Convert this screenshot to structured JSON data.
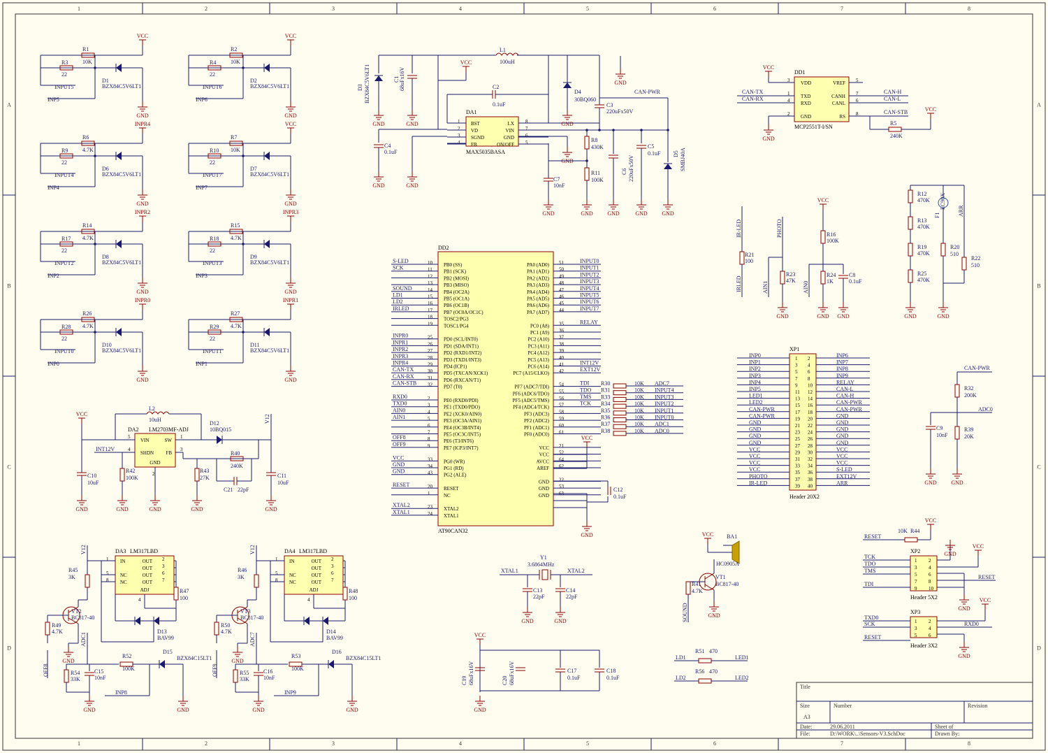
{
  "colors": {
    "wire": "#1a1a6e",
    "part": "#8b0000",
    "fill": "#ffffb0",
    "paper": "#fffdf0"
  },
  "border": {
    "cols": [
      "1",
      "2",
      "3",
      "4",
      "5",
      "6",
      "7",
      "8"
    ],
    "rows": [
      "A",
      "B",
      "C",
      "D"
    ]
  },
  "title_block": {
    "title_label": "Title",
    "size_label": "Size",
    "size": "A3",
    "number_label": "Number",
    "revision_label": "Revision",
    "date_label": "Date:",
    "date": "29.06.2011",
    "file_label": "File:",
    "file": "D:\\WORK\\..\\Sensors-V3.SchDoc",
    "sheet_label": "Sheet   of",
    "drawn_label": "Drawn By:"
  },
  "inputs": [
    {
      "r1": "R1",
      "r1v": "10K",
      "r2": "R3",
      "r2v": "22",
      "d": "D1",
      "dv": "BZX84C5V6LT1",
      "top": "VCC",
      "net": "INPUT5",
      "inp": "INP5"
    },
    {
      "r1": "R2",
      "r1v": "10K",
      "r2": "R4",
      "r2v": "22",
      "d": "D2",
      "dv": "BZX84C5V6LT1",
      "top": "VCC",
      "net": "INPUT6",
      "inp": "INP6"
    },
    {
      "r1": "R6",
      "r1v": "4.7K",
      "r2": "R9",
      "r2v": "22",
      "d": "D6",
      "dv": "BZX84C5V6LT1",
      "top": "INPR4",
      "net": "INPUT4",
      "inp": "INP4"
    },
    {
      "r1": "R7",
      "r1v": "10K",
      "r2": "R10",
      "r2v": "22",
      "d": "D7",
      "dv": "BZX84C5V6LT1",
      "top": "VCC",
      "net": "INPUT7",
      "inp": "INP7"
    },
    {
      "r1": "R14",
      "r1v": "4.7K",
      "r2": "R17",
      "r2v": "22",
      "d": "D8",
      "dv": "BZX84C5V6LT1",
      "top": "INPR2",
      "net": "INPUT2",
      "inp": "INP2"
    },
    {
      "r1": "R15",
      "r1v": "4.7K",
      "r2": "R18",
      "r2v": "22",
      "d": "D9",
      "dv": "BZX84C5V6LT1",
      "top": "INPR3",
      "net": "INPUT3",
      "inp": "INP3"
    },
    {
      "r1": "R26",
      "r1v": "4.7K",
      "r2": "R28",
      "r2v": "22",
      "d": "D10",
      "dv": "BZX84C5V6LT1",
      "top": "INPR0",
      "net": "INPUT0",
      "inp": "INP0"
    },
    {
      "r1": "R27",
      "r1v": "4.7K",
      "r2": "R29",
      "r2v": "22",
      "d": "D11",
      "dv": "BZX84C5V6LT1",
      "top": "INPR1",
      "net": "INPUT1",
      "inp": "INP1"
    }
  ],
  "gnd": "GND",
  "vcc": "VCC",
  "da1": {
    "name": "DA1",
    "part": "MAX5035BASA",
    "lpins": [
      "BST",
      "VD",
      "SGND",
      "FB"
    ],
    "lnum": [
      "1",
      "2",
      "3",
      "4"
    ],
    "rpins": [
      "LX",
      "VIN",
      "GND",
      "ON/OFF"
    ],
    "rnum": [
      "8",
      "7",
      "6",
      "5"
    ],
    "L1": "L1",
    "L1v": "100uH",
    "C2": "C2",
    "C2v": "0.1uF",
    "D3": "D3",
    "D3v": "BZX84C5V6LT1",
    "C1": "C1",
    "C1v": "68uFx16V",
    "D4": "D4",
    "D4v": "30BQ060",
    "C3": "C3",
    "C3v": "220uFx50V",
    "canpwr": "CAN-PWR",
    "C4": "C4",
    "C4v": "0.1uF",
    "R8": "R8",
    "R8v": "430K",
    "R11": "R11",
    "R11v": "100K",
    "C7": "C7",
    "C7v": "10nF",
    "C6": "C6",
    "C6v": "220uFx50V",
    "C5": "C5",
    "C5v": "0.1uF",
    "D5": "D5",
    "D5v": "SMBJ40A"
  },
  "dd1": {
    "name": "DD1",
    "part": "MCP2551T-I/SN",
    "lpins": [
      "VDD",
      "TXD",
      "RXD",
      "GND"
    ],
    "lnum": [
      "3",
      "1",
      "4",
      "2"
    ],
    "rpins": [
      "VREF",
      "CANH",
      "CANL",
      "RS"
    ],
    "rnum": [
      "5",
      "7",
      "6",
      "8"
    ],
    "ln": [
      "CAN-TX",
      "CAN-RX"
    ],
    "rn": [
      "CAN-H",
      "CAN-L",
      "CAN-STB"
    ],
    "R5": "R5",
    "R5v": "240K"
  },
  "dd2": {
    "name": "DD2",
    "part": "AT90CAN32",
    "l": [
      [
        "PB0 (SS)",
        "10",
        "S-LED"
      ],
      [
        "PB1 (SCK)",
        "11",
        "SCK"
      ],
      [
        "PB2 (MOSI)",
        "12",
        ""
      ],
      [
        "PB3 (MISO)",
        "13",
        ""
      ],
      [
        "PB4 (OC2A)",
        "14",
        "SOUND"
      ],
      [
        "PB5 (OC1A)",
        "15",
        "LD1"
      ],
      [
        "PB6 (OC1B)",
        "16",
        "LD2"
      ],
      [
        "PB7 (OC0A/OC1C)",
        "17",
        "IRLED"
      ],
      [
        "TOSC2/PG3",
        "18",
        ""
      ],
      [
        "TOSC1/PG4",
        "19",
        ""
      ],
      [
        "",
        "",
        " "
      ],
      [
        "PD0 (SCL/INT0)",
        "25",
        "INPR0"
      ],
      [
        "PD1 (SDA/INT1)",
        "26",
        "INPR1"
      ],
      [
        "PD2 (RXD1/INT2)",
        "27",
        "INPR2"
      ],
      [
        "PD3 (TXD1/INT3)",
        "28",
        "INPR3"
      ],
      [
        "PD4 (ICP1)",
        "29",
        "INPR4"
      ],
      [
        "PD5 (TXCAN/XCK1)",
        "30",
        "CAN-TX"
      ],
      [
        "PD6 (RXCAN/T1)",
        "31",
        "CAN-RX"
      ],
      [
        "PD7 (T0)",
        "32",
        "CAN-STB"
      ],
      [
        "",
        "",
        " "
      ],
      [
        "PE0 (RXD0/PDI)",
        "2",
        "RXD0"
      ],
      [
        "PE1 (TXD0/PDO)",
        "3",
        "TXD0"
      ],
      [
        "PE2 (XCK0/AIN0)",
        "4",
        "AIN0"
      ],
      [
        "PE3 (OC3A/AIN1)",
        "5",
        "AIN1"
      ],
      [
        "PE4 (OC3B/INT4)",
        "6",
        ""
      ],
      [
        "PE5 (OC3C/INT5)",
        "7",
        ""
      ],
      [
        "PE6 (T3/INT6)",
        "8",
        "OFF8"
      ],
      [
        "PE7 (ICP3/INT7)",
        "9",
        "OFF9"
      ],
      [
        "",
        "",
        " "
      ],
      [
        "PG0 (WR)",
        "33",
        "VCC"
      ],
      [
        "PG1 (RD)",
        "34",
        "GND"
      ],
      [
        "PG2 (ALE)",
        "43",
        "GND"
      ],
      [
        "",
        "",
        " "
      ],
      [
        "RESET",
        "20",
        "RESET"
      ],
      [
        "NC",
        "1",
        ""
      ],
      [
        "",
        "",
        " "
      ],
      [
        "XTAL2",
        "23",
        "XTAL2"
      ],
      [
        "XTAL1",
        "24",
        "XTAL1"
      ]
    ],
    "r": [
      [
        "PA0 (AD0)",
        "51",
        "INPUT0"
      ],
      [
        "PA1 (AD1)",
        "50",
        "INPUT1"
      ],
      [
        "PA2 (AD2)",
        "49",
        "INPUT2"
      ],
      [
        "PA3 (AD3)",
        "48",
        "INPUT3"
      ],
      [
        "PA4 (AD4)",
        "47",
        "INPUT4"
      ],
      [
        "PA5 (AD5)",
        "46",
        "INPUT5"
      ],
      [
        "PA6 (AD6)",
        "45",
        "INPUT6"
      ],
      [
        "PA7 (AD7)",
        "44",
        "INPUT7"
      ],
      [
        "",
        "",
        " "
      ],
      [
        "PC0 (A8)",
        "35",
        "RELAY"
      ],
      [
        "PC1 (A9)",
        "36",
        ""
      ],
      [
        "PC2 (A10)",
        "37",
        ""
      ],
      [
        "PC3 (A11)",
        "38",
        ""
      ],
      [
        "PC4 (A12)",
        "39",
        ""
      ],
      [
        "PC5 (A13)",
        "40",
        ""
      ],
      [
        "PC6 (A14)",
        "41",
        "INT12V"
      ],
      [
        "PC7 (A15/CLKO)",
        "42",
        "EXT12V"
      ],
      [
        "",
        "",
        " "
      ],
      [
        "PF7 (ADC7/TDI)",
        "54",
        "TDI"
      ],
      [
        "PF6 (ADC6/TDO)",
        "55",
        "TDO"
      ],
      [
        "PF5 (ADC5/TMS)",
        "56",
        "TMS"
      ],
      [
        "PF4 (ADC4/TCK)",
        "57",
        "TCK"
      ],
      [
        "PF3 (ADC3)",
        "58",
        ""
      ],
      [
        "PF2 (ADC2)",
        "59",
        ""
      ],
      [
        "PF1 (ADC1)",
        "60",
        ""
      ],
      [
        "PF0 (ADC0)",
        "61",
        ""
      ],
      [
        "",
        "",
        " "
      ],
      [
        "VCC",
        "21",
        ""
      ],
      [
        "VCC",
        "52",
        ""
      ],
      [
        "AVCC",
        "64",
        ""
      ],
      [
        "AREF",
        "62",
        ""
      ],
      [
        "",
        "",
        " "
      ],
      [
        "GND",
        "22",
        ""
      ],
      [
        "GND",
        "53",
        ""
      ],
      [
        "GND",
        "63",
        ""
      ]
    ],
    "res": [
      [
        "R30",
        "10K",
        "ADC7"
      ],
      [
        "R31",
        "10K",
        "INPUT4"
      ],
      [
        "R33",
        "10K",
        "INPUT3"
      ],
      [
        "R34",
        "10K",
        "INPUT2"
      ],
      [
        "R35",
        "10K",
        "INPUT1"
      ],
      [
        "R36",
        "10K",
        "INPUT0"
      ],
      [
        "R37",
        "10K",
        "ADC1"
      ],
      [
        "R38",
        "10K",
        "ADC0"
      ]
    ],
    "C12": "C12",
    "C12v": "0.1uF"
  },
  "xp1": {
    "name": "XP1",
    "part": "Header 20X2",
    "l": [
      "INP0",
      "INP1",
      "INP2",
      "INP3",
      "INP4",
      "INP5",
      "LED1",
      "LED2",
      "CAN-PWR",
      "CAN-PWR",
      "GND",
      "GND",
      "GND",
      "GND",
      "VCC",
      "VCC",
      "VCC",
      "VCC",
      "PHOTO",
      "IR-LED"
    ],
    "r": [
      "INP6",
      "INP7",
      "INP8",
      "INP9",
      "RELAY",
      "CAN-L",
      "CAN-H",
      "CAN-PWR",
      "CAN-PWR",
      "GND",
      "GND",
      "GND",
      "GND",
      "GND",
      "VCC",
      "VCC",
      "VCC",
      "S-LED",
      "EXT12V",
      "ARR"
    ]
  },
  "sensors": {
    "irled": "IR-LED",
    "irled2": "IRLED",
    "R21": "R21",
    "R21v": "100",
    "photo": "PHOTO",
    "ain1": "AIN1",
    "R23": "R23",
    "R23v": "47K",
    "R16": "R16",
    "R16v": "100K",
    "ain0": "AIN0",
    "R24": "R24",
    "R24v": "1K",
    "C8": "C8",
    "C8v": "0.1uF",
    "R12": "R12",
    "R12v": "470K",
    "R13": "R13",
    "R13v": "470K",
    "R19": "R19",
    "R19v": "470K",
    "R25": "R25",
    "R25v": "470K",
    "F1": "F1",
    "F1v": "EC90X",
    "R20": "R20",
    "R20v": "510",
    "R22": "R22",
    "R22v": "510",
    "arr": "ARR"
  },
  "adc": {
    "canpwr": "CAN-PWR",
    "R32": "R32",
    "R32v": "200K",
    "adc0": "ADC0",
    "C9": "C9",
    "C9v": "10nF",
    "R39": "R39",
    "R39v": "20K"
  },
  "da2": {
    "name": "DA2",
    "part": "LM2703MF-ADJ",
    "pins": [
      "VIN",
      "SW",
      "SHDN",
      "FB",
      "GND"
    ],
    "pnum": [
      "5",
      "1",
      "4",
      "3",
      "2"
    ],
    "L2": "L2",
    "L2v": "10uH",
    "D12": "D12",
    "D12v": "10BQ015",
    "v12": "V12",
    "int12": "INT12V",
    "C10": "C10",
    "C10v": "10uF",
    "R42": "R42",
    "R42v": "100K",
    "R43": "R43",
    "R43v": "27K",
    "R40": "R40",
    "R40v": "240K",
    "C21": "C21",
    "C21v": "22pF",
    "C11": "C11",
    "C11v": "10uF"
  },
  "relays": [
    {
      "da": "DA3",
      "part": "LM317LBD",
      "R45": "R45",
      "R45v": "3K",
      "VT": "VT2",
      "VTv": "BC817-40",
      "R49": "R49",
      "R49v": "4.7K",
      "R47": "R47",
      "R47v": "100",
      "D13": "D13",
      "D13v": "BAV99",
      "adc": "ADC1",
      "off": "OFF8",
      "R54": "R54",
      "R54v": "33K",
      "C15": "C15",
      "C15v": "10nF",
      "R52": "R52",
      "R52v": "100K",
      "Dz": "D15",
      "Dzv": "BZX84C15LT1",
      "inp": "INP8"
    },
    {
      "da": "DA4",
      "part": "LM317LBD",
      "R45": "R46",
      "R45v": "3K",
      "VT": "VT3",
      "VTv": "BC817-40",
      "R49": "R50",
      "R49v": "4.7K",
      "R47": "R48",
      "R47v": "100",
      "D13": "D14",
      "D13v": "BAV99",
      "adc": "ADC7",
      "off": "OFF9",
      "R54": "R55",
      "R54v": "33K",
      "C15": "C16",
      "C15v": "10nF",
      "R52": "R53",
      "R52v": "100K",
      "Dz": "D16",
      "Dzv": "BZX84C15LT1",
      "inp": "INP9"
    }
  ],
  "ldo_pins": {
    "l": [
      "IN",
      "NC",
      "NC"
    ],
    "ln": [
      "1",
      "5",
      "8"
    ],
    "r": [
      "OUT",
      "OUT",
      "OUT",
      "OUT"
    ],
    "rn": [
      "2",
      "3",
      "6",
      "7"
    ],
    "adj": "ADJ",
    "adjn": "4"
  },
  "xtal": {
    "Y1": "Y1",
    "Y1v": "3.6864MHz",
    "x1": "XTAL1",
    "x2": "XTAL2",
    "C13": "C13",
    "C13v": "22pF",
    "C14": "C14",
    "C14v": "22pF"
  },
  "decoup": {
    "C19": "C19",
    "C19v": "68uFx16V",
    "C20": "C20",
    "C20v": "68uFx16V",
    "C17": "C17",
    "C17v": "0.1uF",
    "C18": "C18",
    "C18v": "0.1uF"
  },
  "buzzer": {
    "BA1": "BA1",
    "BA1v": "HC0905A",
    "VT1": "VT1",
    "VT1v": "BC817-40",
    "R41": "R41",
    "R41v": "4.7K",
    "sound": "SOUND"
  },
  "leds": {
    "R51": "R51",
    "R51v": "470",
    "R56": "R56",
    "R56v": "470",
    "ld1": "LD1",
    "ld2": "LD2",
    "led1": "LED1",
    "led2": "LED2"
  },
  "xp2": {
    "name": "XP2",
    "part": "Header 5X2",
    "R44": "R44",
    "R44v": "10K",
    "reset": "RESET",
    "tck": "TCK",
    "tdo": "TDO",
    "tms": "TMS",
    "tdi": "TDI",
    "reset2": "RESET"
  },
  "xp3": {
    "name": "XP3",
    "part": "Header 3X2",
    "txd0": "TXD0",
    "sck": "SCK",
    "reset": "RESET",
    "rxd0": "RXD0"
  }
}
